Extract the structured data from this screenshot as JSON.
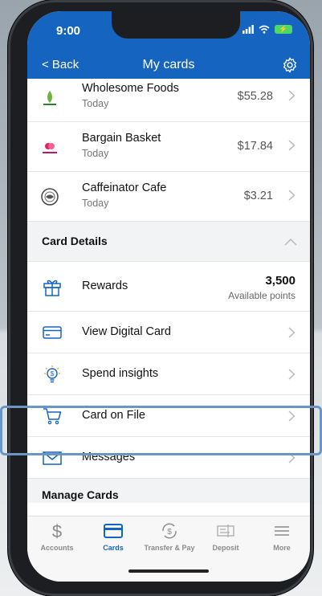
{
  "status": {
    "time": "9:00"
  },
  "nav": {
    "back_label": "< Back",
    "title": "My cards"
  },
  "transactions": [
    {
      "name": "Wholesome Foods",
      "date": "Today",
      "amount": "$55.28"
    },
    {
      "name": "Bargain Basket",
      "date": "Today",
      "amount": "$17.84"
    },
    {
      "name": "Caffeinator Cafe",
      "date": "Today",
      "amount": "$3.21"
    }
  ],
  "card_details": {
    "heading": "Card Details",
    "rewards": {
      "label": "Rewards",
      "points": "3,500",
      "points_label": "Available points"
    },
    "items": [
      {
        "label": "View Digital Card",
        "icon": "card-icon"
      },
      {
        "label": "Spend insights",
        "icon": "lightbulb-dollar-icon"
      },
      {
        "label": "Card on File",
        "icon": "cart-icon"
      },
      {
        "label": "Messages",
        "icon": "envelope-icon"
      }
    ]
  },
  "next_section": {
    "heading": "Manage Cards"
  },
  "tabs": [
    {
      "label": "Accounts",
      "icon": "dollar-icon",
      "active": false
    },
    {
      "label": "Cards",
      "icon": "card-icon",
      "active": true
    },
    {
      "label": "Transfer & Pay",
      "icon": "transfer-icon",
      "active": false
    },
    {
      "label": "Deposit",
      "icon": "check-deposit-icon",
      "active": false
    },
    {
      "label": "More",
      "icon": "menu-icon",
      "active": false
    }
  ],
  "colors": {
    "brand": "#1565c0",
    "highlight": "#6b96c3"
  }
}
